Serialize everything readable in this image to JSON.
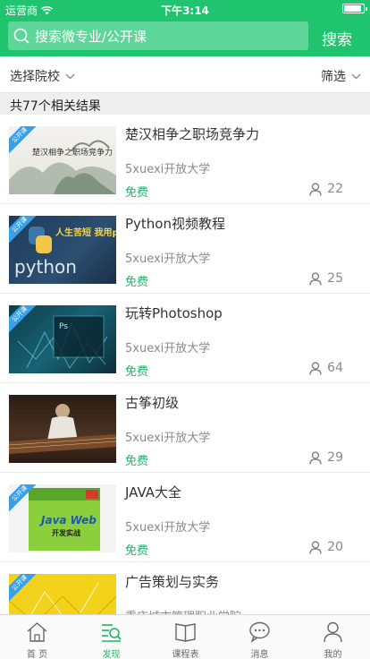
{
  "status_bar": {
    "carrier": "运营商",
    "time": "下午3:14",
    "battery_level": 0.9
  },
  "search": {
    "placeholder": "搜索微专业/公开课",
    "button_label": "搜索"
  },
  "filters": {
    "school_label": "选择院校",
    "filter_label": "筛选"
  },
  "results": {
    "count_text": "共77个相关结果"
  },
  "courses": [
    {
      "title": "楚汉相争之职场竞争力",
      "school": "5xuexi开放大学",
      "price": "免费",
      "learners": "22",
      "badge": "公开课",
      "thumb_text": "楚汉相争之职场竞争力",
      "thumb_theme": "ink-painting"
    },
    {
      "title": "Python视频教程",
      "school": "5xuexi开放大学",
      "price": "免费",
      "learners": "25",
      "badge": "公开课",
      "thumb_text": "人生苦短 我用python",
      "thumb_sub": "python",
      "thumb_theme": "python"
    },
    {
      "title": "玩转Photoshop",
      "school": "5xuexi开放大学",
      "price": "免费",
      "learners": "64",
      "badge": "公开课",
      "thumb_text": "Ps",
      "thumb_theme": "photoshop"
    },
    {
      "title": "古筝初级",
      "school": "5xuexi开放大学",
      "price": "免费",
      "learners": "29",
      "badge": "",
      "thumb_theme": "guzheng"
    },
    {
      "title": "JAVA大全",
      "school": "5xuexi开放大学",
      "price": "免费",
      "learners": "20",
      "badge": "公开课",
      "thumb_text": "Java Web",
      "thumb_sub": "开发实战",
      "thumb_theme": "java-book"
    },
    {
      "title": "广告策划与实务",
      "school": "重庆城市管理职业学院",
      "price": "",
      "learners": "",
      "badge": "公开课",
      "thumb_theme": "yellow-abstract"
    }
  ],
  "tabbar": {
    "items": [
      {
        "label": "首 页",
        "icon": "home-icon",
        "active": false
      },
      {
        "label": "发现",
        "icon": "discover-icon",
        "active": true
      },
      {
        "label": "课程表",
        "icon": "book-icon",
        "active": false
      },
      {
        "label": "消息",
        "icon": "message-icon",
        "active": false
      },
      {
        "label": "我的",
        "icon": "profile-icon",
        "active": false
      }
    ]
  },
  "colors": {
    "brand_green": "#20c46f",
    "search_field": "#5ed69a",
    "price_green": "#20b46a",
    "ribbon_blue": "#3aa0e6"
  }
}
